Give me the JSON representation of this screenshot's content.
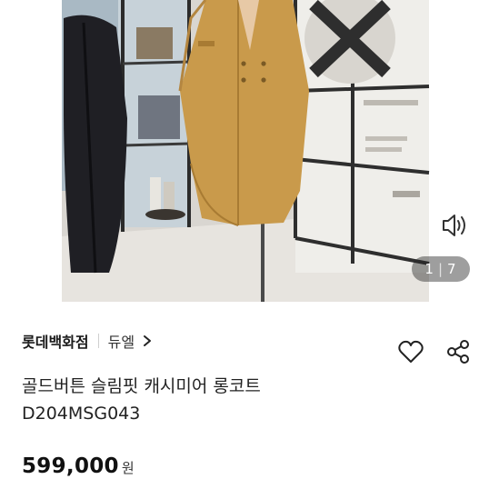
{
  "gallery": {
    "current": "1",
    "total": "7"
  },
  "seller": {
    "store": "롯데백화점",
    "brand": "듀엘"
  },
  "product": {
    "title_line1": "골드버튼 슬림핏 캐시미어 롱코트",
    "title_line2": "D204MSG043",
    "price": "599,000",
    "price_unit": "원"
  },
  "icons": {
    "sound": "speaker-icon",
    "chevron": "chevron-right-icon",
    "like": "heart-icon",
    "share": "share-icon"
  },
  "colors": {
    "coat": "#c99a4b",
    "text": "#222222"
  }
}
